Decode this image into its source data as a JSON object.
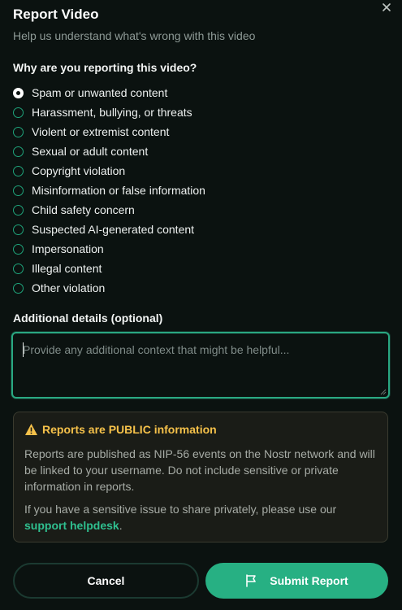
{
  "dialog": {
    "title": "Report Video",
    "subtitle": "Help us understand what's wrong with this video",
    "close_icon": "close-icon"
  },
  "reason": {
    "question": "Why are you reporting this video?",
    "options": [
      {
        "label": "Spam or unwanted content",
        "selected": true
      },
      {
        "label": "Harassment, bullying, or threats",
        "selected": false
      },
      {
        "label": "Violent or extremist content",
        "selected": false
      },
      {
        "label": "Sexual or adult content",
        "selected": false
      },
      {
        "label": "Copyright violation",
        "selected": false
      },
      {
        "label": "Misinformation or false information",
        "selected": false
      },
      {
        "label": "Child safety concern",
        "selected": false
      },
      {
        "label": "Suspected AI-generated content",
        "selected": false
      },
      {
        "label": "Impersonation",
        "selected": false
      },
      {
        "label": "Illegal content",
        "selected": false
      },
      {
        "label": "Other violation",
        "selected": false
      }
    ]
  },
  "details": {
    "label": "Additional details (optional)",
    "value": "",
    "placeholder": "Provide any additional context that might be helpful..."
  },
  "notice": {
    "icon": "warning-icon",
    "title": "Reports are PUBLIC information",
    "paragraph1": "Reports are published as NIP-56 events on the Nostr network and will be linked to your username. Do not include sensitive or private information in reports.",
    "paragraph2_prefix": "If you have a sensitive issue to share privately, please use our",
    "paragraph2_link": "support helpdesk",
    "paragraph2_suffix": ".",
    "accent_color": "#f5c14a"
  },
  "actions": {
    "cancel_label": "Cancel",
    "submit_label": "Submit Report",
    "submit_icon": "flag-icon",
    "submit_color": "#27b083"
  }
}
